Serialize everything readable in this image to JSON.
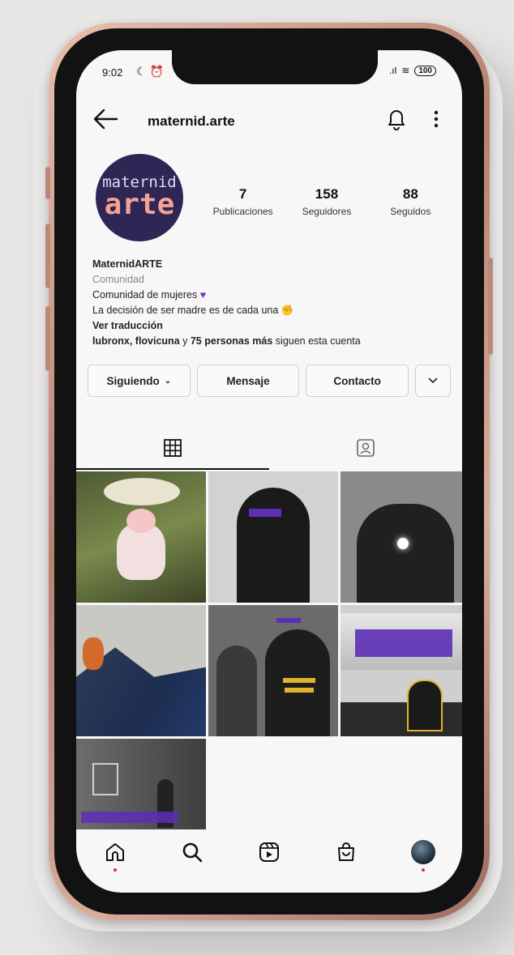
{
  "status": {
    "time": "9:02",
    "battery": "100"
  },
  "topbar": {
    "username": "maternid.arte"
  },
  "avatar": {
    "line1": "maternid",
    "line2": "arte"
  },
  "stats": [
    {
      "num": "7",
      "label": "Publicaciones"
    },
    {
      "num": "158",
      "label": "Seguidores"
    },
    {
      "num": "88",
      "label": "Seguidos"
    }
  ],
  "bio": {
    "name": "MaternidARTE",
    "category": "Comunidad",
    "line1": "Comunidad de mujeres",
    "line2": "La decisión de ser madre es de cada una",
    "translate": "Ver traducción",
    "followed_names": "lubronx, flovicuna",
    "followed_y": " y ",
    "followed_more": "75 personas más",
    "followed_rest": " siguen esta cuenta"
  },
  "actions": {
    "following": "Siguiendo",
    "message": "Mensaje",
    "contact": "Contacto"
  },
  "icons": {
    "grid": "grid-icon",
    "tagged": "tagged-icon",
    "home": "home-icon",
    "search": "search-icon",
    "reels": "reels-icon",
    "shop": "shop-icon"
  },
  "colors": {
    "avatar_bg": "#2f2656",
    "avatar_accent": "#f3a391",
    "heart": "#7a2fc1",
    "notification_dot": "#e12b3b"
  }
}
